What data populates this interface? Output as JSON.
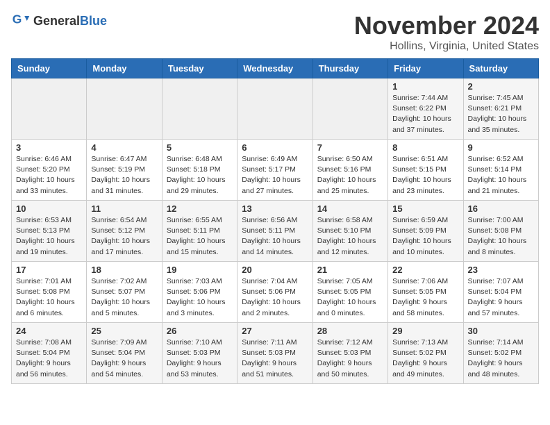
{
  "logo": {
    "general": "General",
    "blue": "Blue"
  },
  "title": "November 2024",
  "subtitle": "Hollins, Virginia, United States",
  "days_header": [
    "Sunday",
    "Monday",
    "Tuesday",
    "Wednesday",
    "Thursday",
    "Friday",
    "Saturday"
  ],
  "weeks": [
    [
      {
        "day": "",
        "info": ""
      },
      {
        "day": "",
        "info": ""
      },
      {
        "day": "",
        "info": ""
      },
      {
        "day": "",
        "info": ""
      },
      {
        "day": "",
        "info": ""
      },
      {
        "day": "1",
        "info": "Sunrise: 7:44 AM\nSunset: 6:22 PM\nDaylight: 10 hours\nand 37 minutes."
      },
      {
        "day": "2",
        "info": "Sunrise: 7:45 AM\nSunset: 6:21 PM\nDaylight: 10 hours\nand 35 minutes."
      }
    ],
    [
      {
        "day": "3",
        "info": "Sunrise: 6:46 AM\nSunset: 5:20 PM\nDaylight: 10 hours\nand 33 minutes."
      },
      {
        "day": "4",
        "info": "Sunrise: 6:47 AM\nSunset: 5:19 PM\nDaylight: 10 hours\nand 31 minutes."
      },
      {
        "day": "5",
        "info": "Sunrise: 6:48 AM\nSunset: 5:18 PM\nDaylight: 10 hours\nand 29 minutes."
      },
      {
        "day": "6",
        "info": "Sunrise: 6:49 AM\nSunset: 5:17 PM\nDaylight: 10 hours\nand 27 minutes."
      },
      {
        "day": "7",
        "info": "Sunrise: 6:50 AM\nSunset: 5:16 PM\nDaylight: 10 hours\nand 25 minutes."
      },
      {
        "day": "8",
        "info": "Sunrise: 6:51 AM\nSunset: 5:15 PM\nDaylight: 10 hours\nand 23 minutes."
      },
      {
        "day": "9",
        "info": "Sunrise: 6:52 AM\nSunset: 5:14 PM\nDaylight: 10 hours\nand 21 minutes."
      }
    ],
    [
      {
        "day": "10",
        "info": "Sunrise: 6:53 AM\nSunset: 5:13 PM\nDaylight: 10 hours\nand 19 minutes."
      },
      {
        "day": "11",
        "info": "Sunrise: 6:54 AM\nSunset: 5:12 PM\nDaylight: 10 hours\nand 17 minutes."
      },
      {
        "day": "12",
        "info": "Sunrise: 6:55 AM\nSunset: 5:11 PM\nDaylight: 10 hours\nand 15 minutes."
      },
      {
        "day": "13",
        "info": "Sunrise: 6:56 AM\nSunset: 5:11 PM\nDaylight: 10 hours\nand 14 minutes."
      },
      {
        "day": "14",
        "info": "Sunrise: 6:58 AM\nSunset: 5:10 PM\nDaylight: 10 hours\nand 12 minutes."
      },
      {
        "day": "15",
        "info": "Sunrise: 6:59 AM\nSunset: 5:09 PM\nDaylight: 10 hours\nand 10 minutes."
      },
      {
        "day": "16",
        "info": "Sunrise: 7:00 AM\nSunset: 5:08 PM\nDaylight: 10 hours\nand 8 minutes."
      }
    ],
    [
      {
        "day": "17",
        "info": "Sunrise: 7:01 AM\nSunset: 5:08 PM\nDaylight: 10 hours\nand 6 minutes."
      },
      {
        "day": "18",
        "info": "Sunrise: 7:02 AM\nSunset: 5:07 PM\nDaylight: 10 hours\nand 5 minutes."
      },
      {
        "day": "19",
        "info": "Sunrise: 7:03 AM\nSunset: 5:06 PM\nDaylight: 10 hours\nand 3 minutes."
      },
      {
        "day": "20",
        "info": "Sunrise: 7:04 AM\nSunset: 5:06 PM\nDaylight: 10 hours\nand 2 minutes."
      },
      {
        "day": "21",
        "info": "Sunrise: 7:05 AM\nSunset: 5:05 PM\nDaylight: 10 hours\nand 0 minutes."
      },
      {
        "day": "22",
        "info": "Sunrise: 7:06 AM\nSunset: 5:05 PM\nDaylight: 9 hours\nand 58 minutes."
      },
      {
        "day": "23",
        "info": "Sunrise: 7:07 AM\nSunset: 5:04 PM\nDaylight: 9 hours\nand 57 minutes."
      }
    ],
    [
      {
        "day": "24",
        "info": "Sunrise: 7:08 AM\nSunset: 5:04 PM\nDaylight: 9 hours\nand 56 minutes."
      },
      {
        "day": "25",
        "info": "Sunrise: 7:09 AM\nSunset: 5:04 PM\nDaylight: 9 hours\nand 54 minutes."
      },
      {
        "day": "26",
        "info": "Sunrise: 7:10 AM\nSunset: 5:03 PM\nDaylight: 9 hours\nand 53 minutes."
      },
      {
        "day": "27",
        "info": "Sunrise: 7:11 AM\nSunset: 5:03 PM\nDaylight: 9 hours\nand 51 minutes."
      },
      {
        "day": "28",
        "info": "Sunrise: 7:12 AM\nSunset: 5:03 PM\nDaylight: 9 hours\nand 50 minutes."
      },
      {
        "day": "29",
        "info": "Sunrise: 7:13 AM\nSunset: 5:02 PM\nDaylight: 9 hours\nand 49 minutes."
      },
      {
        "day": "30",
        "info": "Sunrise: 7:14 AM\nSunset: 5:02 PM\nDaylight: 9 hours\nand 48 minutes."
      }
    ]
  ]
}
